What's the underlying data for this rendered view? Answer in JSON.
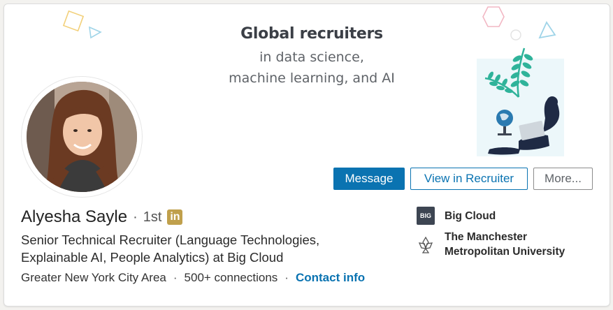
{
  "banner": {
    "title": "Global recruiters",
    "line2": "in data science,",
    "line3": "machine learning, and AI"
  },
  "profile": {
    "name": "Alyesha Sayle",
    "separator": "·",
    "degree": "1st",
    "badge_letter": "in",
    "headline": "Senior Technical Recruiter (Language Technologies, Explainable AI, People Analytics) at Big Cloud",
    "location": "Greater New York City Area",
    "connections": "500+ connections",
    "contact_label": "Contact info"
  },
  "actions": {
    "message": "Message",
    "view_recruiter": "View in Recruiter",
    "more": "More..."
  },
  "orgs": [
    {
      "name": "Big Cloud",
      "logo_text": "BIG",
      "icon": "big-cloud-logo"
    },
    {
      "name": "The Manchester Metropolitan University",
      "icon": "university-logo"
    }
  ],
  "colors": {
    "primary": "#0a73b1",
    "badge": "#c0a04c",
    "teal": "#2fb39a",
    "deco_yellow": "#f2d07a",
    "deco_blue": "#9fd4e8",
    "deco_pink": "#f2b7c4"
  }
}
